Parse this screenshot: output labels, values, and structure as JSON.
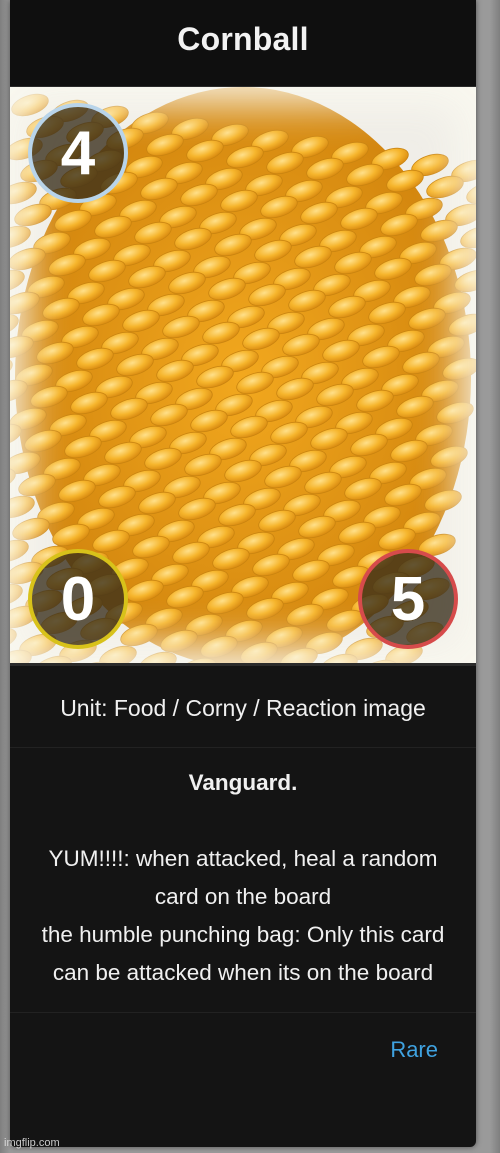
{
  "card": {
    "title": "Cornball",
    "stats": {
      "cost": "4",
      "attack": "0",
      "health": "5"
    },
    "type_line": "Unit: Food / Corny / Reaction image",
    "keyword": "Vanguard.",
    "abilities": [
      "YUM!!!!: when attacked, heal a random card on the board",
      "the humble punching bag: Only this card can be attacked when its on the board"
    ],
    "rarity": "Rare",
    "art_icon": "corn-cob-image"
  },
  "colors": {
    "cost_ring": "#b8d4ea",
    "attack_ring": "#d8c21a",
    "health_ring": "#d64b4b",
    "rarity": "#3fa2e0",
    "card_bg": "#141414"
  },
  "watermark": "imgflip.com"
}
